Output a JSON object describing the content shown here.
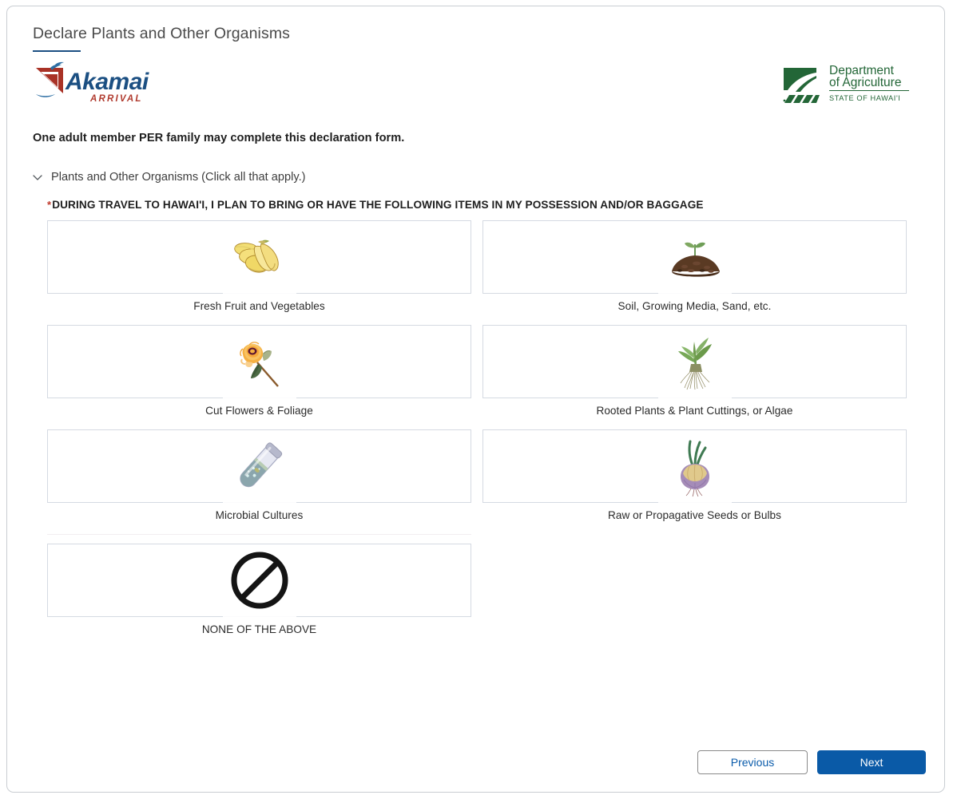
{
  "header": {
    "page_title": "Declare Plants and Other Organisms",
    "accent_color": "#1b4f82",
    "brand_logo": {
      "name": "akamai-arrival-logo",
      "word": "Akamai",
      "subword": "ARRIVAL",
      "word_color": "#1b4f82",
      "subword_color": "#b03a2e",
      "sail_color": "#a93226"
    },
    "agency_logo": {
      "name": "hawaii-department-of-agriculture-logo",
      "line1": "Department",
      "line2": "of Agriculture",
      "line3": "STATE OF HAWAI'I",
      "color": "#236637"
    }
  },
  "notice": {
    "text": "One adult member PER family may complete this declaration form."
  },
  "section": {
    "title": "Plants and Other Organisms (Click all that apply.)",
    "expanded": true,
    "chevron_icon": "chevron-down-icon",
    "required_marker": "*",
    "required_marker_color": "#c0392b",
    "prompt": "DURING TRAVEL TO HAWAI'I, I PLAN TO BRING OR HAVE THE FOLLOWING ITEMS IN MY POSSESSION AND/OR BAGGAGE"
  },
  "options": [
    {
      "id": "fresh-fruit-and-vegetables",
      "label": "Fresh Fruit and Vegetables",
      "icon": "bananas-image",
      "selected": false
    },
    {
      "id": "soil-growing-media-sand",
      "label": "Soil, Growing Media, Sand, etc.",
      "icon": "soil-mound-image",
      "selected": false
    },
    {
      "id": "cut-flowers-and-foliage",
      "label": "Cut Flowers & Foliage",
      "icon": "cut-flower-image",
      "selected": false
    },
    {
      "id": "rooted-plants-cuttings-algae",
      "label": "Rooted Plants & Plant Cuttings, or Algae",
      "icon": "rooted-plant-image",
      "selected": false
    },
    {
      "id": "microbial-cultures",
      "label": "Microbial Cultures",
      "icon": "test-tube-image",
      "selected": false
    },
    {
      "id": "raw-or-propagative-seeds-or-bulbs",
      "label": "Raw or Propagative Seeds or Bulbs",
      "icon": "onion-bulb-image",
      "selected": false
    },
    {
      "id": "none-of-the-above",
      "label": "NONE OF THE ABOVE",
      "icon": "prohibition-sign-image",
      "selected": false
    }
  ],
  "footer": {
    "previous_label": "Previous",
    "next_label": "Next",
    "next_color": "#0a5aa7",
    "previous_text_color": "#0b5cab"
  }
}
